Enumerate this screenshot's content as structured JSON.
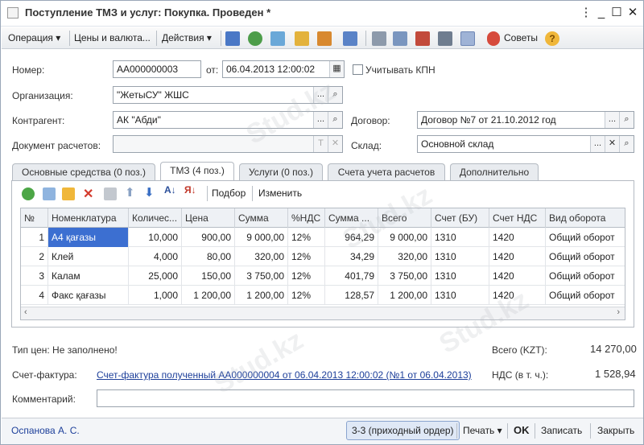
{
  "window": {
    "title": "Поступление ТМЗ и услуг: Покупка. Проведен *",
    "controls": {
      "menu": "⋮",
      "minimize": "_",
      "maximize": "☐",
      "close": "✕"
    }
  },
  "toolbar": {
    "operation": "Операция ▾",
    "prices": "Цены и валюта...",
    "actions": "Действия ▾",
    "tips": "Советы"
  },
  "form": {
    "number_label": "Номер:",
    "number_value": "АА000000003",
    "from_label": "от:",
    "date_value": "06.04.2013 12:00:02",
    "kpn_label": "Учитывать КПН",
    "org_label": "Организация:",
    "org_value": "\"ЖетыСУ\" ЖШС",
    "counterparty_label": "Контрагент:",
    "counterparty_value": "АК \"Абди\"",
    "contract_label": "Договор:",
    "contract_value": "Договор №7 от 21.10.2012 год",
    "settle_doc_label": "Документ расчетов:",
    "settle_doc_value": "",
    "warehouse_label": "Склад:",
    "warehouse_value": "Основной склад"
  },
  "tabs": [
    "Основные средства (0 поз.)",
    "ТМЗ (4 поз.)",
    "Услуги (0 поз.)",
    "Счета учета расчетов",
    "Дополнительно"
  ],
  "table_toolbar": {
    "pick": "Подбор",
    "change": "Изменить"
  },
  "table": {
    "columns": [
      "№",
      "Номенклатура",
      "Количес...",
      "Цена",
      "Сумма",
      "%НДС",
      "Сумма ...",
      "Всего",
      "Счет (БУ)",
      "Счет НДС",
      "Вид оборота"
    ],
    "rows": [
      [
        "1",
        "А4 қағазы",
        "10,000",
        "900,00",
        "9 000,00",
        "12%",
        "964,29",
        "9 000,00",
        "1310",
        "1420",
        "Общий оборот"
      ],
      [
        "2",
        "Клей",
        "4,000",
        "80,00",
        "320,00",
        "12%",
        "34,29",
        "320,00",
        "1310",
        "1420",
        "Общий оборот"
      ],
      [
        "3",
        "Калам",
        "25,000",
        "150,00",
        "3 750,00",
        "12%",
        "401,79",
        "3 750,00",
        "1310",
        "1420",
        "Общий оборот"
      ],
      [
        "4",
        "Факс қағазы",
        "1,000",
        "1 200,00",
        "1 200,00",
        "12%",
        "128,57",
        "1 200,00",
        "1310",
        "1420",
        "Общий оборот"
      ]
    ]
  },
  "footer": {
    "price_type": "Тип цен: Не заполнено!",
    "total_label": "Всего (KZT):",
    "total_value": "14 270,00",
    "invoice_label": "Счет-фактура:",
    "invoice_link": "Счет-фактура полученный АА000000004 от 06.04.2013 12:00:02 (№1 от 06.04.2013)",
    "vat_label": "НДС (в т. ч.):",
    "vat_value": "1 528,94",
    "comment_label": "Комментарий:",
    "comment_value": ""
  },
  "bottom": {
    "user": "Оспанова А. С.",
    "order_btn": "3-3 (приходный ордер)",
    "print_btn": "Печать ▾",
    "ok_btn": "OK",
    "save_btn": "Записать",
    "close_btn": "Закрыть"
  },
  "watermark": "Stud.kz",
  "colors": {
    "accent": "#3c6fd1",
    "link": "#1d3f9a"
  }
}
